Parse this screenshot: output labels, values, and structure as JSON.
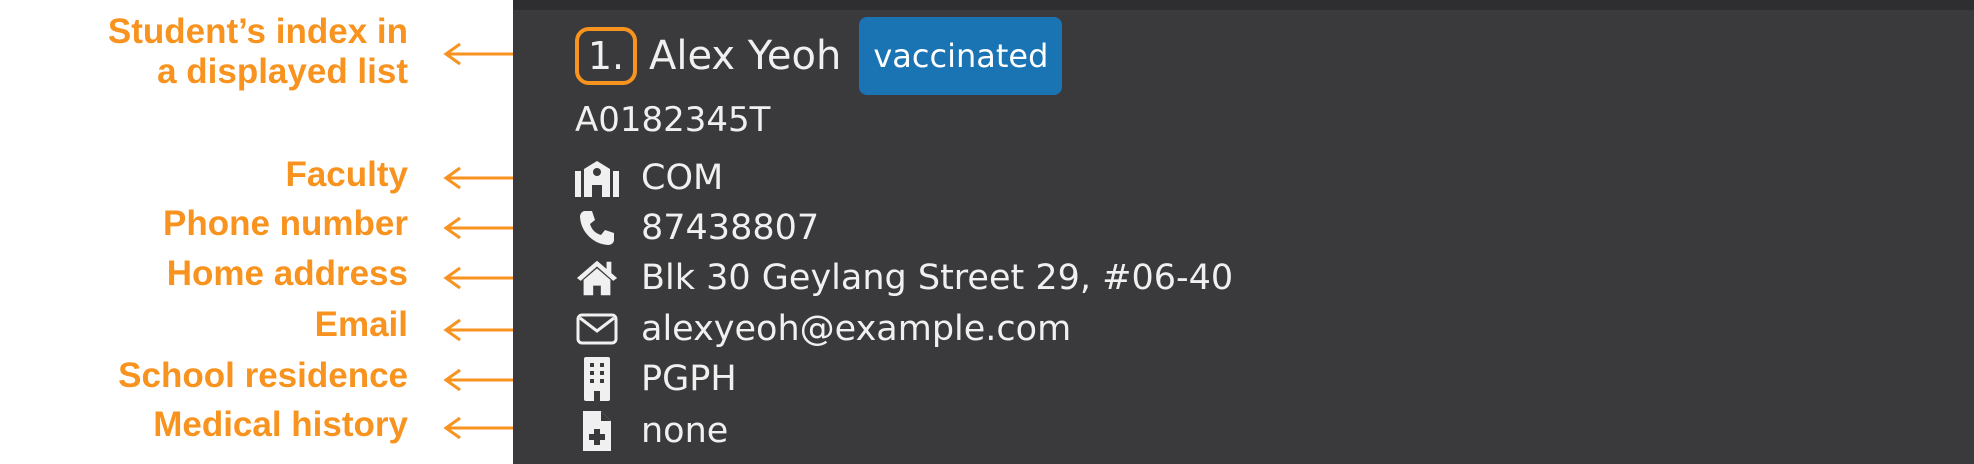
{
  "annotations": {
    "index": [
      "Student’s index in",
      "a displayed list"
    ],
    "faculty": "Faculty",
    "phone": "Phone number",
    "address": "Home address",
    "email": "Email",
    "residence": "School residence",
    "medical": "Medical history"
  },
  "card": {
    "index": "1.",
    "name": "Alex Yeoh",
    "tag": "vaccinated",
    "matric": "A0182345T",
    "faculty": "COM",
    "phone": "87438807",
    "address": "Blk 30 Geylang Street 29, #06-40",
    "email": "alexyeoh@example.com",
    "residence": "PGPH",
    "medical": "none"
  },
  "colors": {
    "annotation": "#f7931e",
    "panel": "#3a3a3c",
    "tag": "#1a74b4"
  },
  "icons": {
    "faculty": "school-building-icon",
    "phone": "phone-icon",
    "address": "home-icon",
    "email": "envelope-icon",
    "residence": "building-icon",
    "medical": "medical-file-icon"
  }
}
